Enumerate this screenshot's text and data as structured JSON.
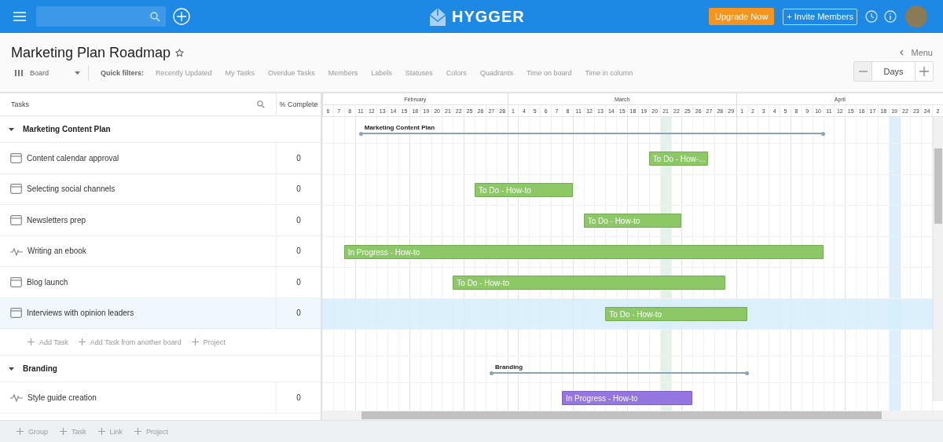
{
  "topbar": {
    "logo": "HYGGER",
    "upgrade_button": "Upgrade Now",
    "invite_button": "+ Invite Members"
  },
  "header": {
    "title": "Marketing Plan Roadmap",
    "starred": false,
    "menu": "Menu"
  },
  "toolbar": {
    "view": "Board",
    "quick_filters_label": "Quick filters:",
    "filters": [
      "Recently Updated",
      "My Tasks",
      "Overdue Tasks",
      "Members",
      "Labels",
      "Statuses",
      "Colors",
      "Quadrants",
      "Time on board",
      "Time in column"
    ],
    "zoom": "Days"
  },
  "table": {
    "columns": [
      "Tasks",
      "% Complete"
    ]
  },
  "timeline": {
    "months": [
      {
        "name": "February",
        "days": [
          "6",
          "7",
          "8",
          "11",
          "12",
          "13",
          "14",
          "15",
          "18",
          "19",
          "20",
          "21",
          "22",
          "25",
          "26",
          "27",
          "28"
        ]
      },
      {
        "name": "March",
        "days": [
          "1",
          "4",
          "5",
          "6",
          "7",
          "8",
          "11",
          "12",
          "13",
          "14",
          "15",
          "18",
          "19",
          "20",
          "21",
          "22",
          "25",
          "26",
          "27",
          "28",
          "29"
        ]
      },
      {
        "name": "April",
        "days": [
          "1",
          "2",
          "3",
          "4",
          "5",
          "8",
          "9",
          "10",
          "11",
          "12",
          "15",
          "16",
          "17",
          "18",
          "19",
          "22",
          "23",
          "24",
          "2"
        ]
      }
    ]
  },
  "groups": [
    {
      "name": "Marketing Content Plan",
      "expanded": true,
      "summary": {
        "label": "Marketing Content Plan"
      },
      "tasks": [
        {
          "name": "Content calendar approval",
          "kind": "card",
          "complete": "0",
          "selected": false,
          "bar": {
            "label": "To Do - How-...",
            "color": "#8cc866"
          }
        },
        {
          "name": "Selecting social channels",
          "kind": "card",
          "complete": "0",
          "selected": false,
          "bar": {
            "label": "To Do - How-to",
            "color": "#8cc866"
          }
        },
        {
          "name": "Newsletters prep",
          "kind": "card",
          "complete": "0",
          "selected": false,
          "bar": {
            "label": "To Do - How-to",
            "color": "#8cc866"
          }
        },
        {
          "name": "Writing an ebook",
          "kind": "pulse",
          "complete": "0",
          "selected": false,
          "bar": {
            "label": "In Progress - How-to",
            "color": "#8cc866"
          }
        },
        {
          "name": "Blog launch",
          "kind": "card",
          "complete": "0",
          "selected": false,
          "bar": {
            "label": "To Do - How-to",
            "color": "#8cc866"
          }
        },
        {
          "name": "Interviews with opinion leaders",
          "kind": "card",
          "complete": "0",
          "selected": true,
          "bar": {
            "label": "To Do - How-to",
            "color": "#8cc866"
          }
        }
      ],
      "actions": [
        "Add Task",
        "Add Task from another board",
        "Project"
      ]
    },
    {
      "name": "Branding",
      "expanded": true,
      "summary": {
        "label": "Branding"
      },
      "tasks": [
        {
          "name": "Style guide creation",
          "kind": "pulse",
          "complete": "0",
          "selected": false,
          "bar": {
            "label": "In Progress - How-to",
            "color": "#9575e0"
          }
        }
      ]
    }
  ],
  "footer": {
    "actions": [
      "Group",
      "Task",
      "Link",
      "Project"
    ]
  }
}
